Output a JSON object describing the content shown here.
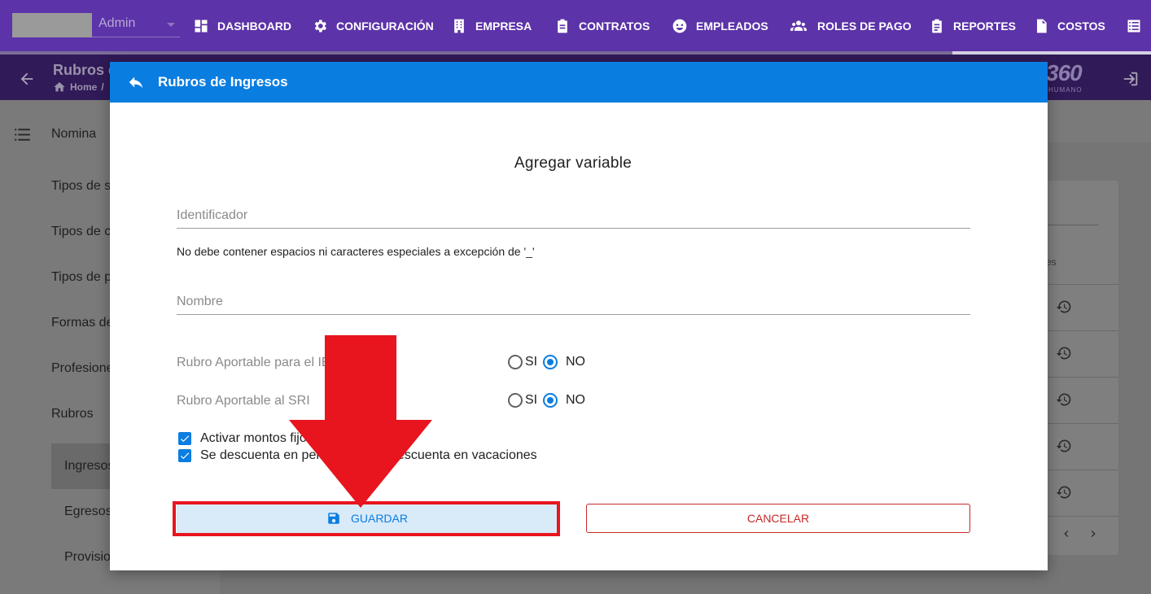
{
  "topnav": {
    "admin_value": "Admin",
    "items": [
      {
        "label": "DASHBOARD",
        "icon": "dashboard-icon"
      },
      {
        "label": "CONFIGURACIÓN",
        "icon": "gear-icon"
      },
      {
        "label": "EMPRESA",
        "icon": "building-icon"
      },
      {
        "label": "CONTRATOS",
        "icon": "clipboard-icon"
      },
      {
        "label": "EMPLEADOS",
        "icon": "user-face-icon"
      },
      {
        "label": "ROLES DE PAGO",
        "icon": "users-icon"
      },
      {
        "label": "REPORTES",
        "icon": "clipboard-list-icon"
      },
      {
        "label": "COSTOS",
        "icon": "file-dollar-icon"
      },
      {
        "label": "",
        "icon": "list-icon"
      }
    ]
  },
  "header": {
    "title": "Rubros d",
    "breadcrumb_home": "Home",
    "breadcrumb_sep": "/",
    "brand": "360",
    "brand_sub": "HUMANO"
  },
  "sidebar": {
    "title": "Nomina",
    "items": [
      "Tipos de s",
      "Tipos de c",
      "Tipos de p",
      "Formas de",
      "Profesione",
      "Rubros"
    ],
    "sub_items": [
      "Ingresos",
      "Egresos",
      "Provisio"
    ],
    "active_sub": "Ingresos"
  },
  "background_card": {
    "column_header_fragment": "es"
  },
  "modal": {
    "title": "Rubros de Ingresos",
    "form_title": "Agregar variable",
    "identificador_placeholder": "Identificador",
    "identificador_value": "",
    "hint": "No debe contener espacios ni caracteres especiales a excepción de '_'",
    "nombre_placeholder": "Nombre",
    "nombre_value": "",
    "radio_groups": [
      {
        "label": "Rubro Aportable para el IE",
        "options": [
          "SI",
          "NO"
        ],
        "selected": "NO"
      },
      {
        "label": "Rubro Aportable al SRI",
        "options": [
          "SI",
          "NO"
        ],
        "selected": "NO"
      }
    ],
    "checkboxes": [
      {
        "label": "Activar montos fijo",
        "checked": true
      },
      {
        "label": "Se descuenta en per",
        "checked": true
      }
    ],
    "checkbox2_right_fragment": "escuenta en vacaciones",
    "save_label": "GUARDAR",
    "cancel_label": "CANCELAR"
  },
  "colors": {
    "topnav": "#5c33a8",
    "modal_header": "#0a7de0",
    "save_bg": "#d9eaf9",
    "cancel": "#c62828",
    "annotation": "#e8141e"
  }
}
